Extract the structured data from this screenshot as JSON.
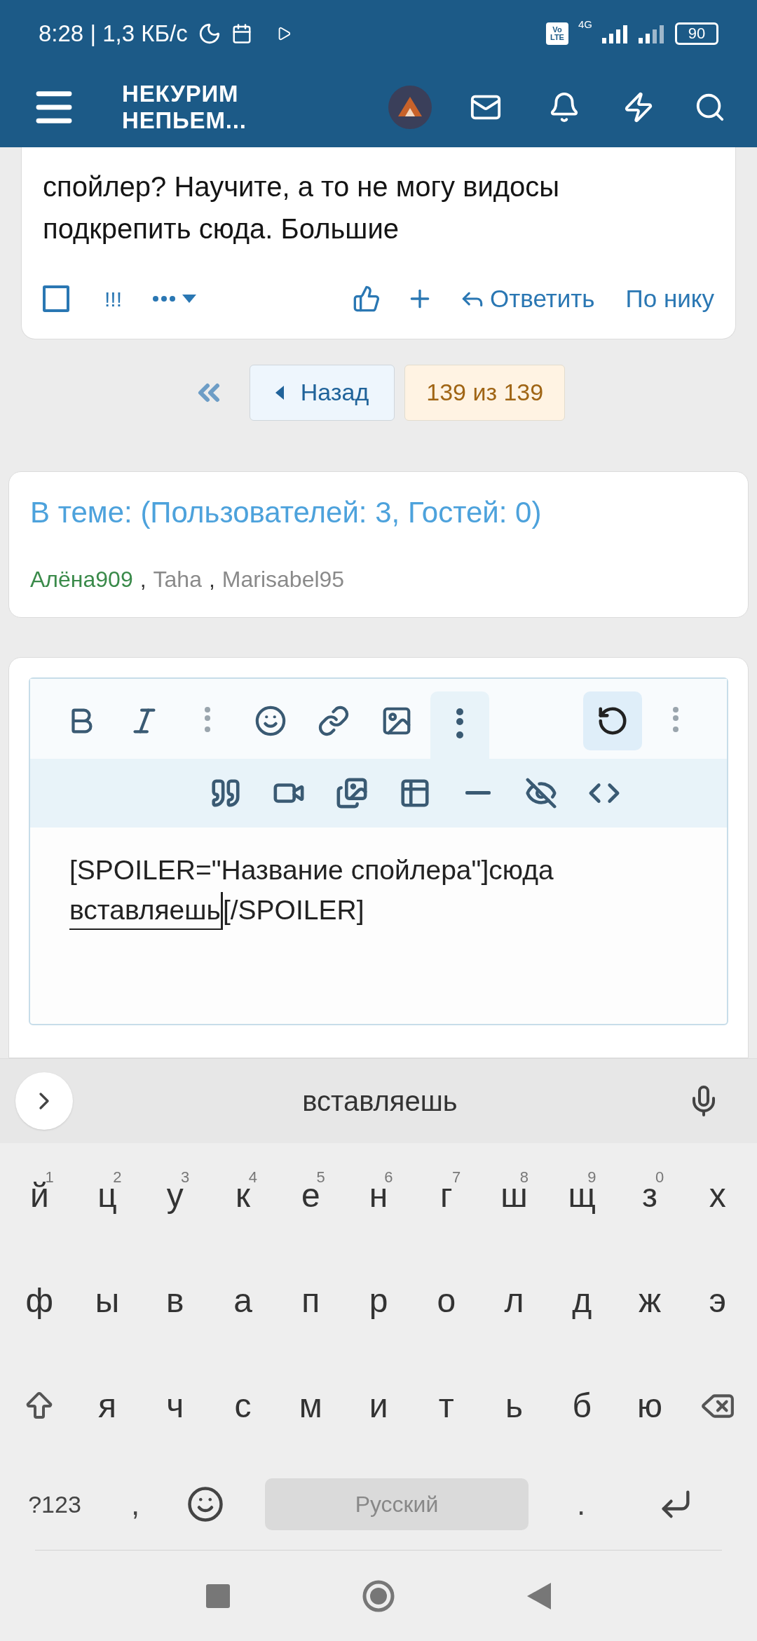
{
  "status_bar": {
    "time": "8:28 | 1,3 КБ/с",
    "volte_top": "Vo",
    "volte_bottom": "LTE",
    "network": "4G",
    "battery": "90"
  },
  "header": {
    "logo_line1": "НЕКУРИМ",
    "logo_line2": "НЕПЬЕМ..."
  },
  "post": {
    "lines": [
      "спойлер? Научите, а то не могу видосы",
      "подкрепить сюда. Большие"
    ],
    "checked": false,
    "marks": "!!!",
    "reply": "Ответить",
    "quote_by_nick": "По нику"
  },
  "pagination": {
    "back": "Назад",
    "page": "139 из 139"
  },
  "online": {
    "title": "В теме: (Пользователей: 3, Гостей: 0)",
    "separator": ",",
    "users": [
      {
        "name": "Алёна909",
        "color": "#3a8a4a"
      },
      {
        "name": "Taha",
        "color": "#8a8a8a"
      },
      {
        "name": "Marisabel95",
        "color": "#8a8a8a"
      }
    ]
  },
  "editor": {
    "toolbar": [
      {
        "kind": "bold"
      },
      {
        "kind": "italic"
      },
      {
        "kind": "dots"
      },
      {
        "kind": "smile"
      },
      {
        "kind": "link"
      },
      {
        "kind": "image"
      },
      {
        "kind": "more"
      }
    ],
    "more_expanded": true,
    "toolbar_right": [
      {
        "kind": "undo"
      },
      {
        "kind": "dots"
      }
    ],
    "undo_highlighted": true,
    "toolbar2": [
      {
        "kind": "quote"
      },
      {
        "kind": "video"
      },
      {
        "kind": "gallery"
      },
      {
        "kind": "table"
      },
      {
        "kind": "rule"
      },
      {
        "kind": "hide"
      },
      {
        "kind": "code"
      }
    ],
    "text_line1": "[SPOILER=\"Название спойлера\"]сюда",
    "text_word": "вставляешь",
    "text_rest": "[/SPOILER]"
  },
  "keyboard": {
    "suggestion": "вставляешь",
    "rows": [
      [
        {
          "kind": "key",
          "label": "й",
          "hint": "1"
        },
        {
          "kind": "key",
          "label": "ц",
          "hint": "2"
        },
        {
          "kind": "key",
          "label": "у",
          "hint": "3"
        },
        {
          "kind": "key",
          "label": "к",
          "hint": "4"
        },
        {
          "kind": "key",
          "label": "е",
          "hint": "5"
        },
        {
          "kind": "key",
          "label": "н",
          "hint": "6"
        },
        {
          "kind": "key",
          "label": "г",
          "hint": "7"
        },
        {
          "kind": "key",
          "label": "ш",
          "hint": "8"
        },
        {
          "kind": "key",
          "label": "щ",
          "hint": "9"
        },
        {
          "kind": "key",
          "label": "з",
          "hint": "0"
        },
        {
          "kind": "key",
          "label": "х"
        }
      ],
      [
        {
          "kind": "key",
          "label": "ф"
        },
        {
          "kind": "key",
          "label": "ы"
        },
        {
          "kind": "key",
          "label": "в"
        },
        {
          "kind": "key",
          "label": "а"
        },
        {
          "kind": "key",
          "label": "п"
        },
        {
          "kind": "key",
          "label": "р"
        },
        {
          "kind": "key",
          "label": "о"
        },
        {
          "kind": "key",
          "label": "л"
        },
        {
          "kind": "key",
          "label": "д"
        },
        {
          "kind": "key",
          "label": "ж"
        },
        {
          "kind": "key",
          "label": "э"
        }
      ],
      [
        {
          "kind": "shift"
        },
        {
          "kind": "key",
          "label": "я"
        },
        {
          "kind": "key",
          "label": "ч"
        },
        {
          "kind": "key",
          "label": "с"
        },
        {
          "kind": "key",
          "label": "м"
        },
        {
          "kind": "key",
          "label": "и"
        },
        {
          "kind": "key",
          "label": "т"
        },
        {
          "kind": "key",
          "label": "ь"
        },
        {
          "kind": "key",
          "label": "б"
        },
        {
          "kind": "key",
          "label": "ю"
        },
        {
          "kind": "backspace"
        }
      ]
    ],
    "symbols": "?123",
    "comma": ",",
    "space": "Русский",
    "period": "."
  }
}
